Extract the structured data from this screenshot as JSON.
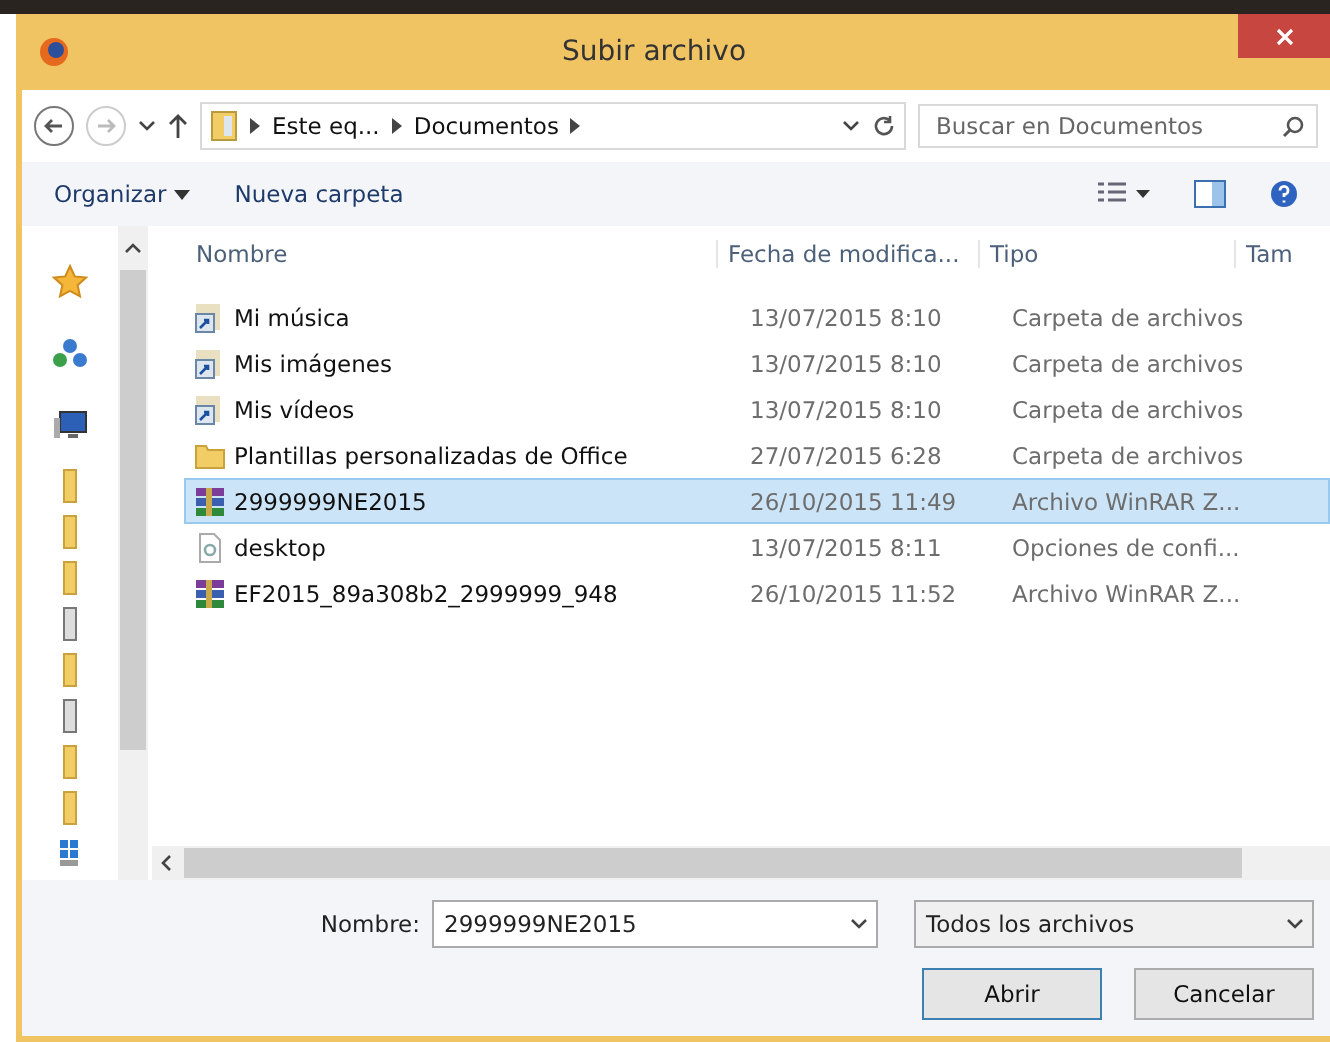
{
  "window": {
    "title": "Subir archivo"
  },
  "address": {
    "crumbs": [
      "Este eq...",
      "Documentos"
    ]
  },
  "search": {
    "placeholder": "Buscar en Documentos"
  },
  "toolbar": {
    "organize": "Organizar",
    "new_folder": "Nueva carpeta"
  },
  "table": {
    "columns": [
      "Nombre",
      "Fecha de modifica...",
      "Tipo",
      "Tam"
    ],
    "rows": [
      {
        "kind": "shortcut",
        "name": "Mi música",
        "date": "13/07/2015 8:10",
        "type": "Carpeta de archivos",
        "selected": false
      },
      {
        "kind": "shortcut",
        "name": "Mis imágenes",
        "date": "13/07/2015 8:10",
        "type": "Carpeta de archivos",
        "selected": false
      },
      {
        "kind": "shortcut",
        "name": "Mis vídeos",
        "date": "13/07/2015 8:10",
        "type": "Carpeta de archivos",
        "selected": false
      },
      {
        "kind": "folder",
        "name": "Plantillas personalizadas de Office",
        "date": "27/07/2015 6:28",
        "type": "Carpeta de archivos",
        "selected": false
      },
      {
        "kind": "archive",
        "name": "2999999NE2015",
        "date": "26/10/2015 11:49",
        "type": "Archivo WinRAR Z...",
        "selected": true
      },
      {
        "kind": "settings",
        "name": "desktop",
        "date": "13/07/2015 8:11",
        "type": "Opciones de confi...",
        "selected": false
      },
      {
        "kind": "archive",
        "name": "EF2015_89a308b2_2999999_948",
        "date": "26/10/2015 11:52",
        "type": "Archivo WinRAR Z...",
        "selected": false
      }
    ]
  },
  "footer": {
    "name_label": "Nombre:",
    "name_value": "2999999NE2015",
    "filter": "Todos los archivos",
    "open": "Abrir",
    "cancel": "Cancelar"
  }
}
